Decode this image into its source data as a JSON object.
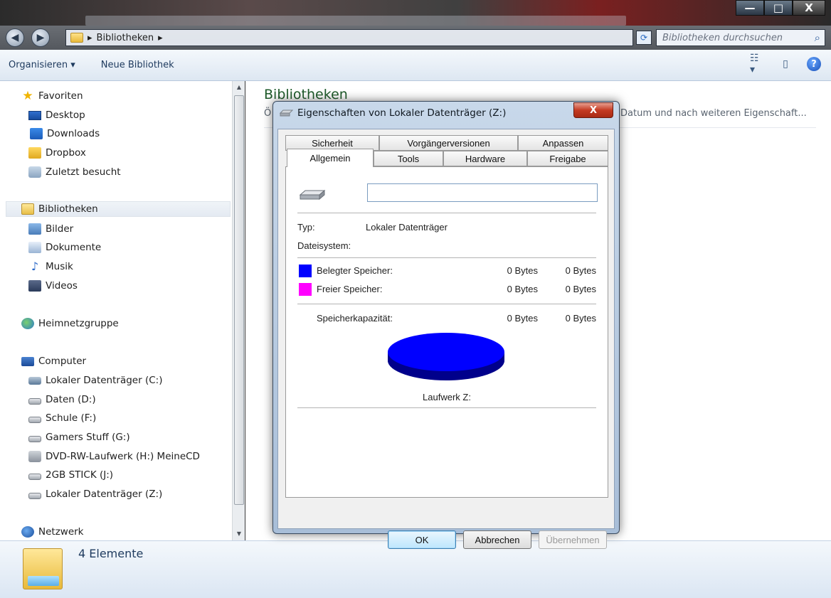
{
  "window": {
    "minimize_label": "—",
    "maximize_label": "□",
    "close_label": "X"
  },
  "address": {
    "path_separator": "▸",
    "path": "Bibliotheken",
    "search_placeholder": "Bibliotheken durchsuchen"
  },
  "toolbar": {
    "organize_label": "Organisieren ▾",
    "new_library_label": "Neue Bibliothek",
    "help_label": "?"
  },
  "nav": {
    "favorites": {
      "header": "Favoriten",
      "items": [
        "Desktop",
        "Downloads",
        "Dropbox",
        "Zuletzt besucht"
      ]
    },
    "libraries": {
      "header": "Bibliotheken",
      "items": [
        "Bilder",
        "Dokumente",
        "Musik",
        "Videos"
      ]
    },
    "homegroup": "Heimnetzgruppe",
    "computer": {
      "header": "Computer",
      "items": [
        "Lokaler Datenträger (C:)",
        "Daten (D:)",
        "Schule  (F:)",
        "Gamers Stuff (G:)",
        "DVD-RW-Laufwerk (H:) MeineCD",
        "2GB STICK (J:)",
        "Lokaler Datenträger (Z:)"
      ]
    },
    "network": "Netzwerk"
  },
  "content": {
    "title": "Bibliotheken",
    "subtitle_start": "Ö",
    "subtitle_end": "Datum und nach weiteren Eigenschaft..."
  },
  "status": {
    "count": "4 Elemente"
  },
  "dialog": {
    "title": "Eigenschaften von Lokaler Datenträger (Z:)",
    "close_label": "X",
    "tabs_row1": [
      "Sicherheit",
      "Vorgängerversionen",
      "Anpassen"
    ],
    "tabs_row2": [
      "Allgemein",
      "Tools",
      "Hardware",
      "Freigabe"
    ],
    "active_tab": "Allgemein",
    "name_value": "",
    "type_label": "Typ:",
    "type_value": "Lokaler Datenträger",
    "fs_label": "Dateisystem:",
    "used_label": "Belegter Speicher:",
    "used_bytes": "0 Bytes",
    "used_gb": "0 Bytes",
    "free_label": "Freier Speicher:",
    "free_bytes": "0 Bytes",
    "free_gb": "0 Bytes",
    "capacity_label": "Speicherkapazität:",
    "capacity_bytes": "0 Bytes",
    "capacity_gb": "0 Bytes",
    "drive_label": "Laufwerk Z:",
    "used_color": "#0000ff",
    "free_color": "#ff00ff",
    "ok_label": "OK",
    "cancel_label": "Abbrechen",
    "apply_label": "Übernehmen"
  }
}
